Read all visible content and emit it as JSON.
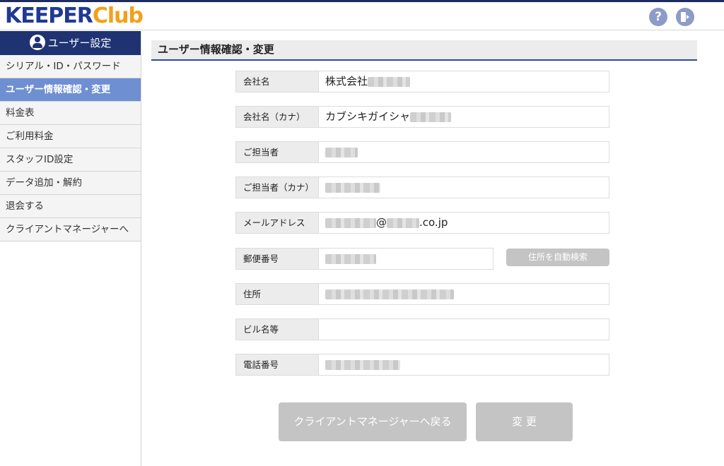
{
  "header": {
    "logo_part1": "KEEPER",
    "logo_part2": "Club",
    "help_icon": "?",
    "logo_colors": {
      "keeper": "#1f3a93",
      "club": "#f2a01b"
    }
  },
  "sidebar": {
    "heading": "ユーザー設定",
    "items": [
      {
        "label": "シリアル・ID・パスワード",
        "active": false
      },
      {
        "label": "ユーザー情報確認・変更",
        "active": true
      },
      {
        "label": "料金表",
        "active": false
      },
      {
        "label": "ご利用料金",
        "active": false
      },
      {
        "label": "スタッフID設定",
        "active": false
      },
      {
        "label": "データ追加・解約",
        "active": false
      },
      {
        "label": "退会する",
        "active": false
      },
      {
        "label": "クライアントマネージャーへ",
        "active": false
      }
    ]
  },
  "main": {
    "title": "ユーザー情報確認・変更",
    "fields": {
      "company": {
        "label": "会社名",
        "value": "株式会社"
      },
      "company_kana": {
        "label": "会社名（カナ）",
        "value": "カブシキガイシャ"
      },
      "contact": {
        "label": "ご担当者",
        "value": ""
      },
      "contact_kana": {
        "label": "ご担当者（カナ）",
        "value": ""
      },
      "email": {
        "label": "メールアドレス",
        "value_at": "@",
        "value_domain": ".co.jp"
      },
      "zip": {
        "label": "郵便番号",
        "value": ""
      },
      "address": {
        "label": "住所",
        "value": ""
      },
      "building": {
        "label": "ビル名等",
        "value": ""
      },
      "phone": {
        "label": "電話番号",
        "value": ""
      }
    },
    "zip_search_label": "住所を自動検索",
    "back_button_label": "クライアントマネージャーへ戻る",
    "change_button_label": "変 更"
  }
}
